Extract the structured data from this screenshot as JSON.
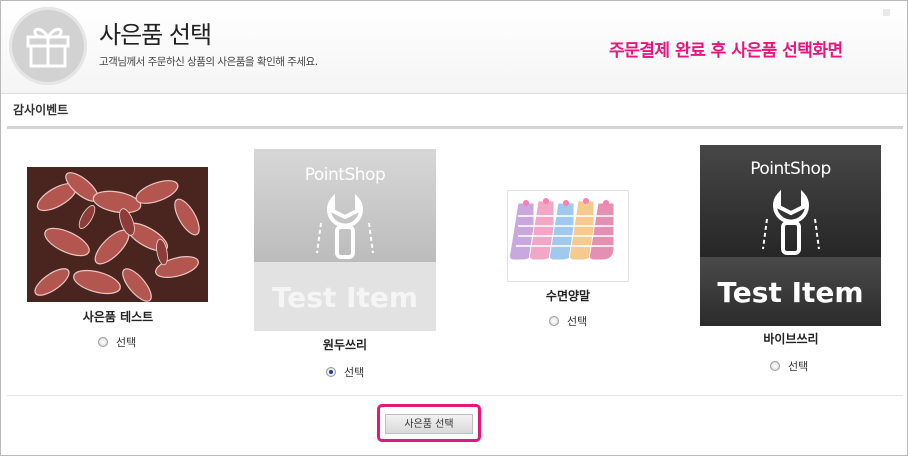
{
  "header": {
    "title": "사은품 선택",
    "subtitle": "고객님께서 주문하신 상품의 사은품을 확인해 주세요.",
    "annotation": "주문결제 완료 후 사은품 선택화면"
  },
  "section": {
    "label": "감사이벤트"
  },
  "items": [
    {
      "name": "사은품 테스트",
      "radio_label": "선택",
      "checked": false
    },
    {
      "name": "원두쓰리",
      "radio_label": "선택",
      "checked": true,
      "logo_text": "PointShop",
      "overlay_text": "Test Item"
    },
    {
      "name": "수면양말",
      "radio_label": "선택",
      "checked": false
    },
    {
      "name": "바이브쓰리",
      "radio_label": "선택",
      "checked": false,
      "logo_text": "PointShop",
      "overlay_text": "Test Item"
    }
  ],
  "submit": {
    "label": "사은품 선택"
  },
  "colors": {
    "accent": "#e8157e",
    "radio_dot": "#1f3e8c"
  }
}
